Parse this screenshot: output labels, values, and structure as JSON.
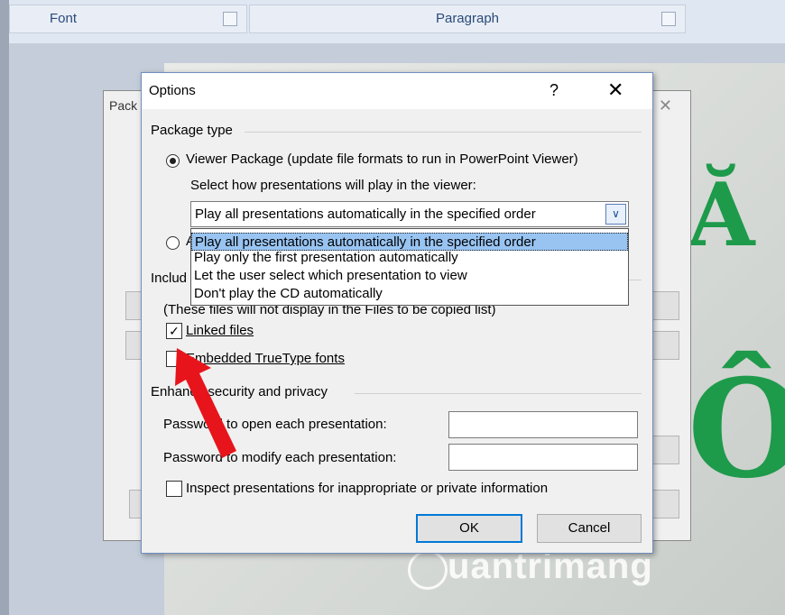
{
  "ribbon": {
    "groups": [
      {
        "label": "Font"
      },
      {
        "label": "Paragraph"
      }
    ]
  },
  "slide": {
    "letter1": "Ă",
    "letter2": "Ô",
    "watermark": "uantrimang"
  },
  "package_dialog": {
    "title_fragment": "Pack"
  },
  "options": {
    "title": "Options",
    "help_glyph": "?",
    "close_glyph": "✕",
    "package_type": {
      "heading": "Package type",
      "viewer_label": "Viewer Package (update file formats to run in PowerPoint Viewer)",
      "viewer_selected": true,
      "select_prompt": "Select how presentations will play in the viewer:",
      "select_value": "Play all presentations automatically in the specified order",
      "options": [
        "Play all presentations automatically in the specified order",
        "Play only the first presentation automatically",
        "Let the user select which presentation to view",
        "Don't play the CD automatically"
      ],
      "archive_fragment": "A"
    },
    "include": {
      "heading_fragment": "Includ",
      "note": "(These files will not display in the Files to be copied list)",
      "linked_files": {
        "label": "Linked files",
        "checked": true
      },
      "embedded_fonts": {
        "label": "Embedded TrueType fonts",
        "checked": false
      }
    },
    "security": {
      "heading": "Enhance security and privacy",
      "open_password_label": "Password to open each presentation:",
      "open_password_value": "",
      "modify_password_label": "Password to modify each presentation:",
      "modify_password_value": "",
      "inspect": {
        "label": "Inspect presentations for inappropriate or private information",
        "checked": false
      }
    },
    "buttons": {
      "ok": "OK",
      "cancel": "Cancel"
    }
  },
  "colors": {
    "slide_letter": "#1e9a4b",
    "annotation_arrow": "#e8141b",
    "selection": "#99c4f2"
  }
}
